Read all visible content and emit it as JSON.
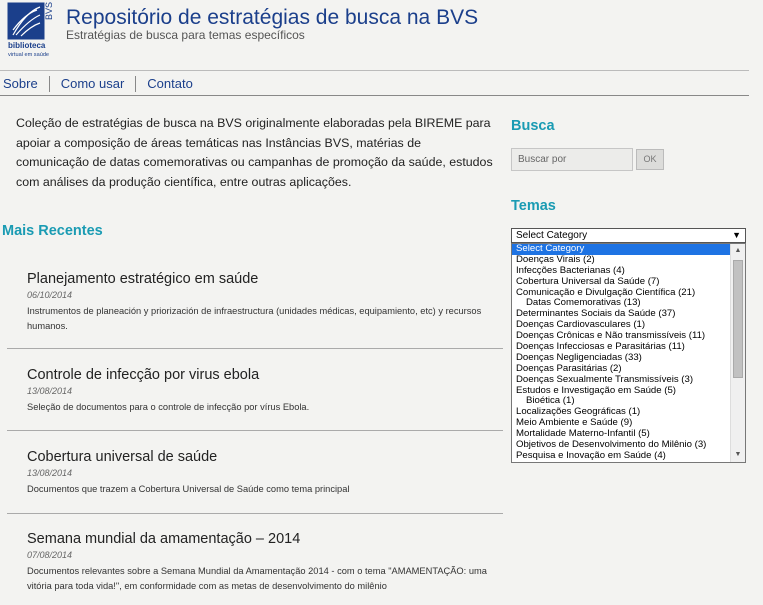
{
  "header": {
    "logo_text_top": "BVS",
    "logo_line1": "biblioteca",
    "logo_line2": "virtual em saúde",
    "title": "Repositório de estratégias de busca na BVS",
    "subtitle": "Estratégias de busca para temas específicos"
  },
  "nav": {
    "items": [
      "Sobre",
      "Como usar",
      "Contato"
    ]
  },
  "intro": "Coleção de estratégias de busca na BVS originalmente elaboradas pela BIREME para apoiar a composição de áreas temáticas nas Instâncias BVS, matérias de comunicação de datas comemorativas ou campanhas de promoção da saúde, estudos com análises da produção científica, entre outras aplicações.",
  "recent": {
    "title": "Mais Recentes",
    "posts": [
      {
        "title": "Planejamento estratégico em saúde",
        "date": "06/10/2014",
        "excerpt": "Instrumentos de planeación y priorización de infraestructura (unidades médicas, equipamiento, etc) y recursos humanos."
      },
      {
        "title": "Controle de infecção por virus ebola",
        "date": "13/08/2014",
        "excerpt": "Seleção de documentos para o controle de infecção por vírus Ebola."
      },
      {
        "title": "Cobertura universal de saúde",
        "date": "13/08/2014",
        "excerpt": "Documentos que trazem a Cobertura Universal de Saúde como tema principal"
      },
      {
        "title": "Semana mundial da amamentação – 2014",
        "date": "07/08/2014",
        "excerpt": "Documentos relevantes sobre a Semana Mundial da Amamentação 2014 - com o tema \"AMAMENTAÇÃO: uma vitória para toda vida!\", em conformidade com as metas de desenvolvimento do milênio"
      }
    ]
  },
  "sidebar": {
    "busca_title": "Busca",
    "search_placeholder": "Buscar por",
    "ok_label": "OK",
    "temas_title": "Temas",
    "select_value": "Select Category",
    "options": [
      "Select Category",
      "Doenças Virais  (2)",
      "Infecções Bacterianas  (4)",
      "Cobertura Universal da Saúde  (7)",
      "Comunicação e Divulgação Científica  (21)",
      "Datas Comemorativas  (13)",
      "Determinantes Sociais da Saúde  (37)",
      "Doenças Cardiovasculares   (1)",
      "Doenças Crônicas e Não transmissíveis  (11)",
      "Doenças Infecciosas e Parasitárias  (11)",
      "Doenças Negligenciadas  (33)",
      "Doenças Parasitárias  (2)",
      "Doenças Sexualmente Transmissíveis  (3)",
      "Estudos e Investigação em Saúde  (5)",
      "Bioética  (1)",
      "Localizações Geográficas  (1)",
      "Meio Ambiente e Saúde  (9)",
      "Mortalidade Materno-Infantil  (5)",
      "Objetivos de Desenvolvimento do Milênio  (3)",
      "Pesquisa e Inovação em Saúde  (4)"
    ]
  },
  "colors": {
    "title_blue": "#1b3f8b",
    "section_teal": "#1a9bb3",
    "selected_option": "#1e73e3",
    "background": "#f3f3f1"
  }
}
